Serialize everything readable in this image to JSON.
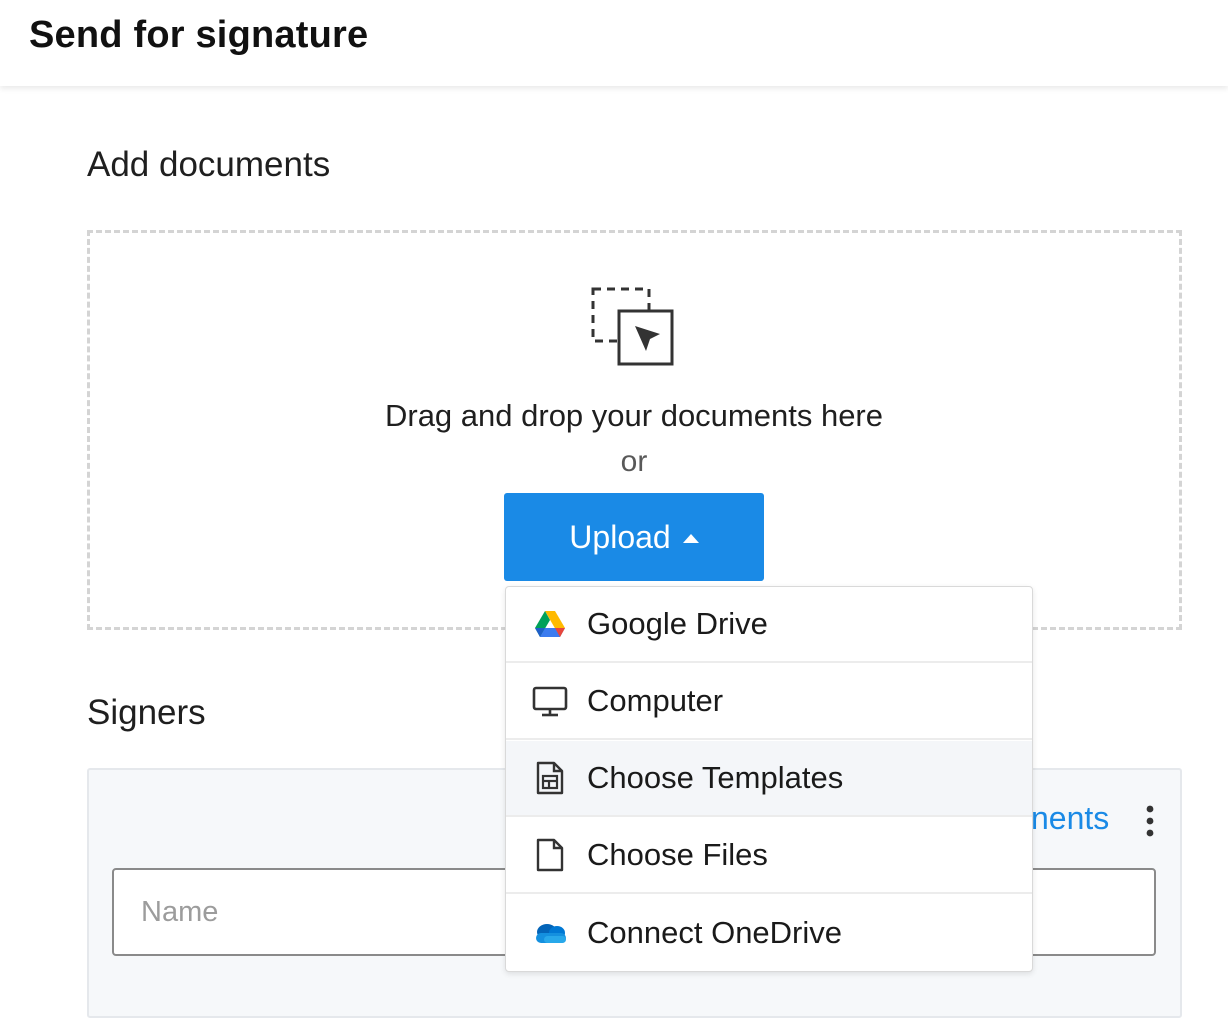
{
  "header": {
    "title": "Send for signature"
  },
  "add_documents": {
    "heading": "Add documents",
    "drag_text": "Drag and drop your documents here",
    "or_text": "or",
    "upload_label": "Upload"
  },
  "upload_menu": {
    "items": [
      {
        "label": "Google Drive",
        "icon": "google-drive-icon"
      },
      {
        "label": "Computer",
        "icon": "monitor-icon"
      },
      {
        "label": "Choose Templates",
        "icon": "template-icon"
      },
      {
        "label": "Choose Files",
        "icon": "file-icon"
      },
      {
        "label": "Connect OneDrive",
        "icon": "onedrive-icon"
      }
    ]
  },
  "signers": {
    "heading": "Signers",
    "recipients_link": "nents",
    "name_placeholder": "Name"
  },
  "colors": {
    "accent": "#1a8ae6",
    "menu_highlight": "#f4f6f9",
    "signers_box": "#f6f8fa"
  }
}
